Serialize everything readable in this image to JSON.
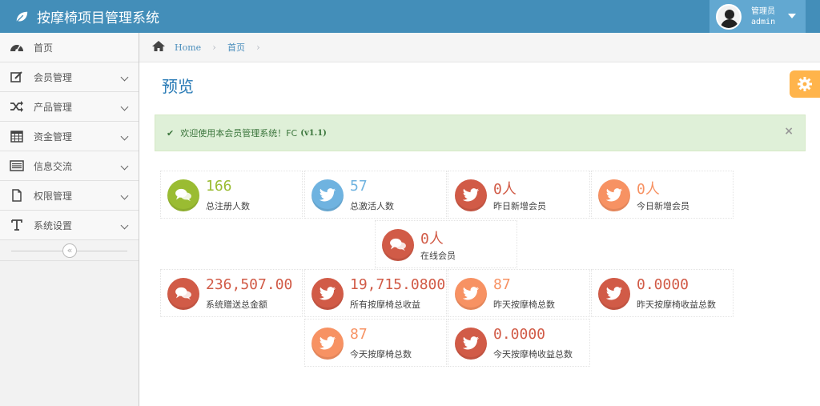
{
  "header": {
    "title": "按摩椅项目管理系统"
  },
  "user": {
    "role": "管理员",
    "name": "admin"
  },
  "sidebar": {
    "items": [
      {
        "label": "首页",
        "icon": "dashboard-icon"
      },
      {
        "label": "会员管理",
        "icon": "edit-icon"
      },
      {
        "label": "产品管理",
        "icon": "shuffle-icon"
      },
      {
        "label": "资金管理",
        "icon": "calendar-icon"
      },
      {
        "label": "信息交流",
        "icon": "list-icon"
      },
      {
        "label": "权限管理",
        "icon": "file-icon"
      },
      {
        "label": "系统设置",
        "icon": "text-icon"
      }
    ],
    "collapse_symbol": "«"
  },
  "breadcrumb": {
    "home": "Home",
    "current": "首页"
  },
  "page": {
    "title": "预览"
  },
  "alert": {
    "message": "欢迎使用本会员管理系统！FC",
    "version": "(v1.1)",
    "close": "×"
  },
  "stats": [
    {
      "value": "166",
      "label": "总注册人数",
      "color": "#9abc32",
      "icon": "comments-icon"
    },
    {
      "value": "57",
      "label": "总激活人数",
      "color": "#6fb3e0",
      "icon": "twitter-icon"
    },
    {
      "value": "0人",
      "label": "昨日新增会员",
      "color": "#d15b47",
      "icon": "twitter-icon"
    },
    {
      "value": "0人",
      "label": "今日新增会员",
      "color": "#f79263",
      "icon": "twitter-icon"
    },
    {
      "value": "0人",
      "label": "在线会员",
      "color": "#d15b47",
      "icon": "comments-icon"
    },
    {
      "value": "236,507.00",
      "label": "系统赠送总金额",
      "color": "#d15b47",
      "icon": "comments-icon"
    },
    {
      "value": "19,715.0800",
      "label": "所有按摩椅总收益",
      "color": "#d15b47",
      "icon": "twitter-icon"
    },
    {
      "value": "87",
      "label": "昨天按摩椅总数",
      "color": "#f79263",
      "icon": "twitter-icon"
    },
    {
      "value": "0.0000",
      "label": "昨天按摩椅收益总数",
      "color": "#d15b47",
      "icon": "twitter-icon"
    },
    {
      "value": "87",
      "label": "今天按摩椅总数",
      "color": "#f79263",
      "icon": "twitter-icon"
    },
    {
      "value": "0.0000",
      "label": "今天按摩椅收益总数",
      "color": "#d15b47",
      "icon": "twitter-icon"
    }
  ]
}
